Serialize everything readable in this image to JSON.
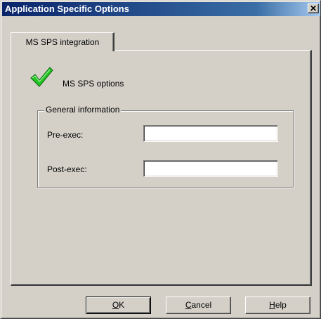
{
  "window": {
    "title": "Application Specific Options",
    "close_glyph": "✕"
  },
  "tabs": [
    {
      "label": "MS SPS integration",
      "selected": true
    }
  ],
  "panel": {
    "icon": "green-checkmark-icon",
    "options_label": "MS SPS options",
    "group": {
      "legend": "General information",
      "fields": [
        {
          "label": "Pre-exec:",
          "value": "",
          "placeholder": ""
        },
        {
          "label": "Post-exec:",
          "value": "",
          "placeholder": ""
        }
      ]
    }
  },
  "buttons": {
    "ok": {
      "mnemonic": "O",
      "rest": "K"
    },
    "cancel": {
      "mnemonic": "C",
      "rest": "ancel"
    },
    "help": {
      "mnemonic": "H",
      "rest": "elp"
    }
  },
  "colors": {
    "title_bar": "#0a246a",
    "checkmark": "#22c422",
    "dialog_face": "#d4d0c8"
  }
}
